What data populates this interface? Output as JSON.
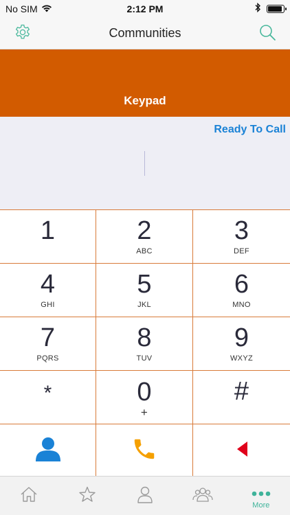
{
  "status_bar": {
    "carrier": "No SIM",
    "time": "2:12 PM",
    "battery_level": 0.9
  },
  "nav": {
    "title": "Communities",
    "left_icon": "gear-icon",
    "right_icon": "search-icon"
  },
  "header": {
    "title": "Keypad"
  },
  "display": {
    "status": "Ready To Call",
    "number": ""
  },
  "keys": [
    {
      "digit": "1",
      "letters": ""
    },
    {
      "digit": "2",
      "letters": "ABC"
    },
    {
      "digit": "3",
      "letters": "DEF"
    },
    {
      "digit": "4",
      "letters": "GHI"
    },
    {
      "digit": "5",
      "letters": "JKL"
    },
    {
      "digit": "6",
      "letters": "MNO"
    },
    {
      "digit": "7",
      "letters": "PQRS"
    },
    {
      "digit": "8",
      "letters": "TUV"
    },
    {
      "digit": "9",
      "letters": "WXYZ"
    },
    {
      "digit": "*",
      "letters": ""
    },
    {
      "digit": "0",
      "letters": "+"
    },
    {
      "digit": "#",
      "letters": ""
    }
  ],
  "actions": {
    "contacts_icon": "contact-person-icon",
    "call_icon": "phone-icon",
    "delete_icon": "backspace-icon"
  },
  "colors": {
    "accent_orange": "#d25b00",
    "status_blue": "#1a82d6",
    "tab_green": "#3fb39a",
    "call_orange": "#f5a000",
    "contact_blue": "#1a82d6",
    "delete_red": "#e0001b"
  },
  "tabs": [
    {
      "icon": "home-icon",
      "label": ""
    },
    {
      "icon": "star-icon",
      "label": ""
    },
    {
      "icon": "person-icon",
      "label": ""
    },
    {
      "icon": "group-icon",
      "label": ""
    },
    {
      "icon": "more-dots-icon",
      "label": "More"
    }
  ]
}
